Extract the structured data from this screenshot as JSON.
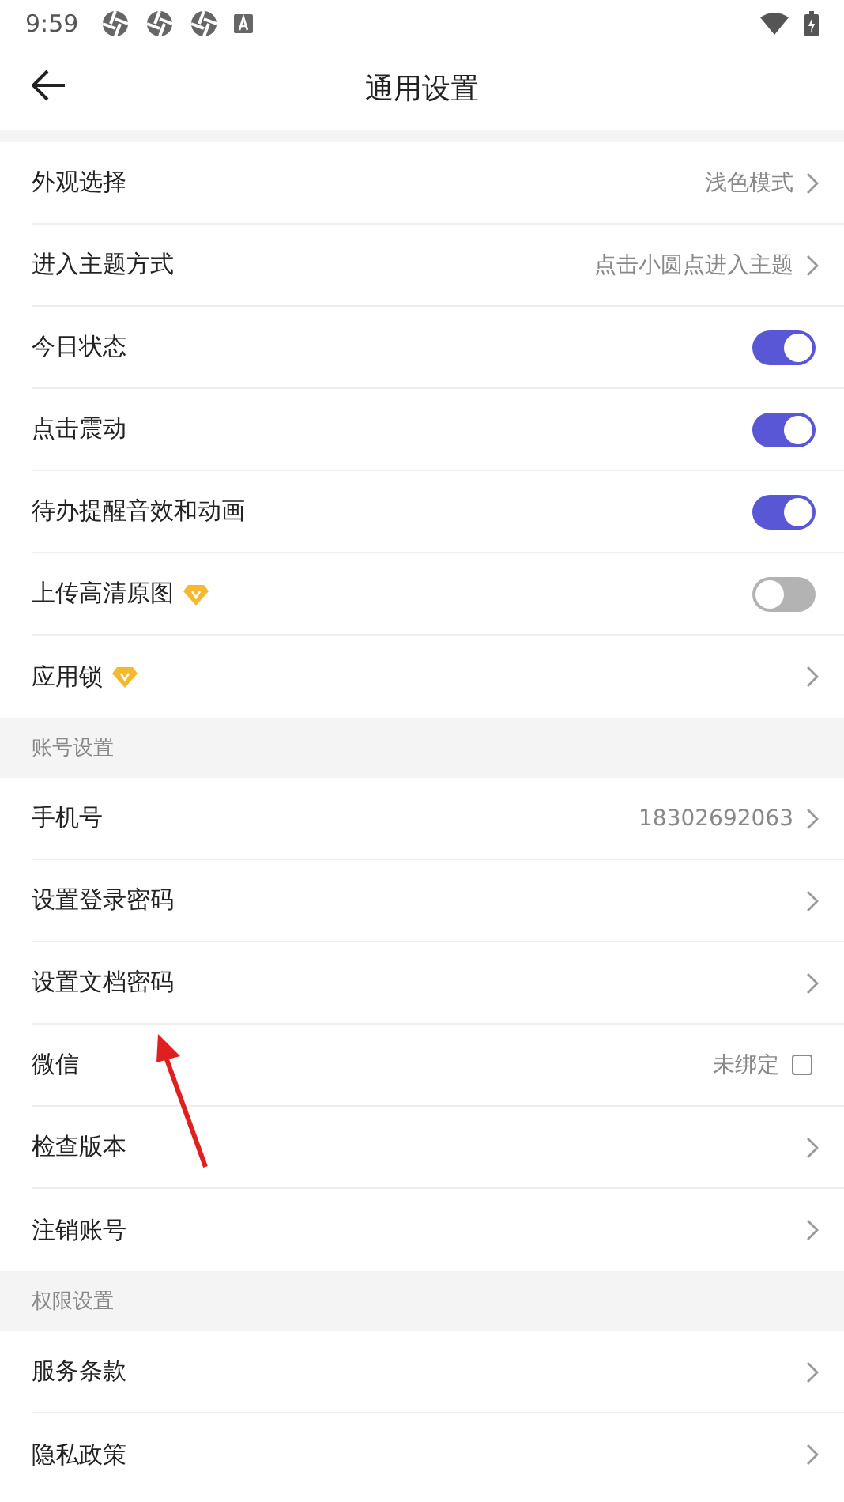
{
  "status_bar": {
    "time": "9:59"
  },
  "header": {
    "title": "通用设置"
  },
  "sections": [
    {
      "rows": [
        {
          "kind": "link",
          "label": "外观选择",
          "value": "浅色模式",
          "vip": false
        },
        {
          "kind": "link",
          "label": "进入主题方式",
          "value": "点击小圆点进入主题",
          "vip": false
        },
        {
          "kind": "toggle",
          "label": "今日状态",
          "on": true,
          "vip": false
        },
        {
          "kind": "toggle",
          "label": "点击震动",
          "on": true,
          "vip": false
        },
        {
          "kind": "toggle",
          "label": "待办提醒音效和动画",
          "on": true,
          "vip": false
        },
        {
          "kind": "toggle",
          "label": "上传高清原图",
          "on": false,
          "vip": true
        },
        {
          "kind": "link",
          "label": "应用锁",
          "vip": true
        }
      ]
    },
    {
      "title": "账号设置",
      "rows": [
        {
          "kind": "link",
          "label": "手机号",
          "value": "18302692063",
          "vip": false
        },
        {
          "kind": "link",
          "label": "设置登录密码",
          "vip": false
        },
        {
          "kind": "link",
          "label": "设置文档密码",
          "vip": false
        },
        {
          "kind": "check",
          "label": "微信",
          "value": "未绑定",
          "checked": false,
          "vip": false
        },
        {
          "kind": "link",
          "label": "检查版本",
          "vip": false
        },
        {
          "kind": "link",
          "label": "注销账号",
          "vip": false
        }
      ]
    },
    {
      "title": "权限设置",
      "rows": [
        {
          "kind": "link",
          "label": "服务条款",
          "vip": false
        },
        {
          "kind": "link",
          "label": "隐私政策",
          "vip": false
        }
      ]
    }
  ]
}
